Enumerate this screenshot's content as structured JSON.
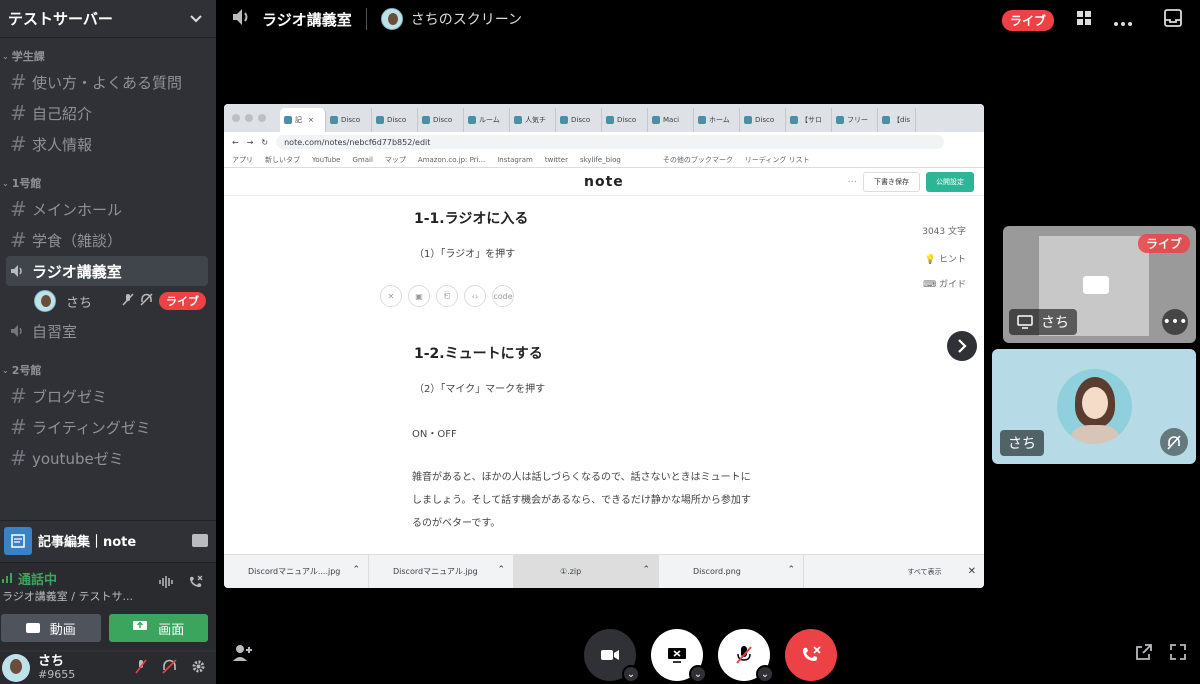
{
  "server": {
    "name": "テストサーバー",
    "categories": [
      {
        "name": "学生課",
        "channels": [
          {
            "name": "使い方・よくある質問",
            "type": "text"
          },
          {
            "name": "自己紹介",
            "type": "text"
          },
          {
            "name": "求人情報",
            "type": "text"
          }
        ]
      },
      {
        "name": "1号館",
        "channels": [
          {
            "name": "メインホール",
            "type": "text"
          },
          {
            "name": "学食（雑談）",
            "type": "text"
          },
          {
            "name": "ラジオ講義室",
            "type": "voice",
            "active": true
          },
          {
            "name": "自習室",
            "type": "voice"
          }
        ]
      },
      {
        "name": "2号館",
        "channels": [
          {
            "name": "ブログゼミ",
            "type": "text"
          },
          {
            "name": "ライティングゼミ",
            "type": "text"
          },
          {
            "name": "youtubeゼミ",
            "type": "text"
          }
        ]
      }
    ],
    "voice_user": {
      "name": "さち",
      "badge": "ライブ"
    }
  },
  "notice": {
    "text": "記事編集｜note"
  },
  "voice_panel": {
    "status": "通話中",
    "subtitle": "ラジオ講義室 / テストサ...",
    "video_label": "動画",
    "screen_label": "画面"
  },
  "user": {
    "name": "さち",
    "tag": "#9655"
  },
  "topbar": {
    "channel": "ラジオ講義室",
    "stream_title": "さちのスクリーン",
    "live": "ライブ"
  },
  "stream": {
    "tabs": [
      "記",
      "Disco",
      "Disco",
      "Disco",
      "ルーム",
      "人気チ",
      "Disco",
      "Disco",
      "Maci",
      "ホーム",
      "Disco",
      "【サロ",
      "フリー",
      "【dis"
    ],
    "url": "note.com/notes/nebcf6d77b852/edit",
    "bookmarks": [
      "アプリ",
      "新しいタブ",
      "YouTube",
      "Gmail",
      "マップ",
      "Amazon.co.jp: Pri...",
      "Instagram",
      "twitter",
      "skylife_blog",
      "その他のブックマーク",
      "リーディング リスト"
    ],
    "logo": "note",
    "draft": "下書き保存",
    "publish": "公開設定",
    "heading1": "1-1.ラジオに入る",
    "step1": "（1）「ラジオ」を押す",
    "heading2": "1-2.ミュートにする",
    "step2": "（2）「マイク」マークを押す",
    "onoff": "ON・OFF",
    "para1": "雑音があると、ほかの人は話しづらくなるので、話さないときはミュートに",
    "para2": "しましょう。そして話す機会があるなら、できるだけ静かな場所から参加す",
    "para3": "るのがベターです。",
    "charcount": "3043 文字",
    "hint": "ヒント",
    "guide": "ガイド",
    "downloads": [
      "Discordマニュアル....jpg",
      "Discordマニュアル.jpg",
      "①.zip",
      "Discord.png"
    ],
    "show_all": "すべて表示"
  },
  "tiles": {
    "tile1_name": "さち",
    "tile1_live": "ライブ",
    "tile2_name": "さち"
  }
}
